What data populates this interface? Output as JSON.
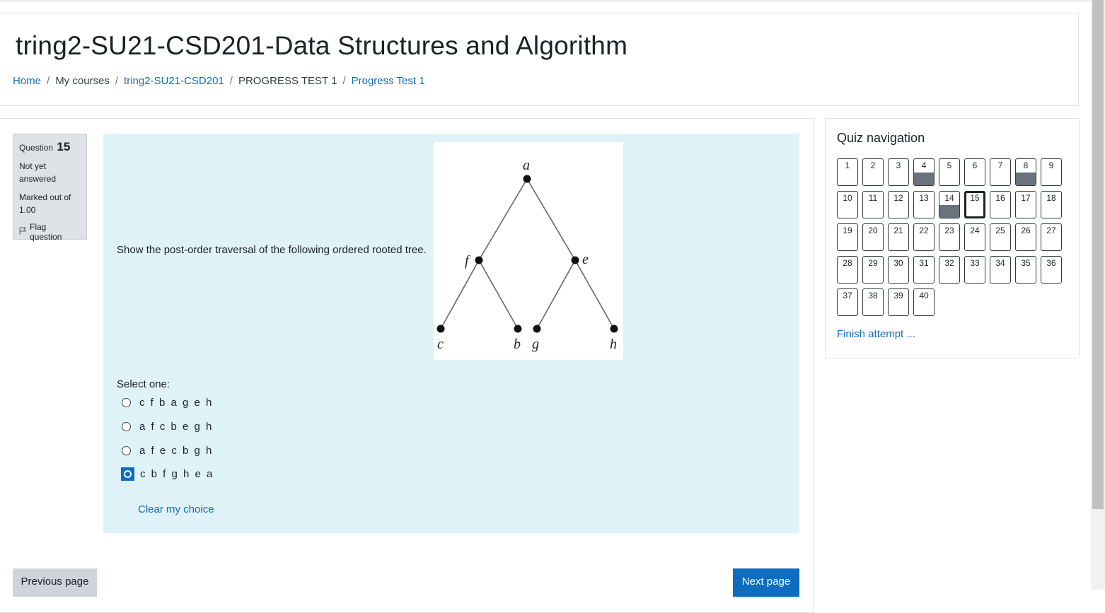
{
  "header": {
    "course_title": "tring2-SU21-CSD201-Data Structures and Algorithm",
    "breadcrumb": [
      {
        "label": "Home",
        "link": true
      },
      {
        "label": "My courses",
        "link": false
      },
      {
        "label": "tring2-SU21-CSD201",
        "link": true
      },
      {
        "label": "PROGRESS TEST 1",
        "link": false
      },
      {
        "label": "Progress Test 1",
        "link": true
      }
    ],
    "separator": "/"
  },
  "question_info": {
    "question_label": "Question",
    "question_number": "15",
    "state": "Not yet answered",
    "grade": "Marked out of 1.00",
    "flag_label": "Flag question"
  },
  "question": {
    "text": "Show the post-order traversal of the following ordered rooted tree.",
    "tree_labels": {
      "a": "a",
      "f": "f",
      "e": "e",
      "c": "c",
      "b": "b",
      "g": "g",
      "h": "h"
    },
    "select_label": "Select one:",
    "options": [
      {
        "label": "c f b a g e h",
        "checked": false
      },
      {
        "label": "a f c b e g h",
        "checked": false
      },
      {
        "label": "a f e c b g h",
        "checked": false
      },
      {
        "label": "c b f g h e a",
        "checked": true
      }
    ],
    "clear_label": "Clear my choice"
  },
  "footer": {
    "prev_label": "Previous page",
    "next_label": "Next page"
  },
  "quiz_nav": {
    "title": "Quiz navigation",
    "questions": [
      {
        "n": "1",
        "answered": false
      },
      {
        "n": "2",
        "answered": false
      },
      {
        "n": "3",
        "answered": false
      },
      {
        "n": "4",
        "answered": true
      },
      {
        "n": "5",
        "answered": false
      },
      {
        "n": "6",
        "answered": false
      },
      {
        "n": "7",
        "answered": false
      },
      {
        "n": "8",
        "answered": true
      },
      {
        "n": "9",
        "answered": false
      },
      {
        "n": "10",
        "answered": false
      },
      {
        "n": "11",
        "answered": false
      },
      {
        "n": "12",
        "answered": false
      },
      {
        "n": "13",
        "answered": false
      },
      {
        "n": "14",
        "answered": true
      },
      {
        "n": "15",
        "answered": false,
        "current": true
      },
      {
        "n": "16",
        "answered": false
      },
      {
        "n": "17",
        "answered": false
      },
      {
        "n": "18",
        "answered": false
      },
      {
        "n": "19",
        "answered": false
      },
      {
        "n": "20",
        "answered": false
      },
      {
        "n": "21",
        "answered": false
      },
      {
        "n": "22",
        "answered": false
      },
      {
        "n": "23",
        "answered": false
      },
      {
        "n": "24",
        "answered": false
      },
      {
        "n": "25",
        "answered": false
      },
      {
        "n": "26",
        "answered": false
      },
      {
        "n": "27",
        "answered": false
      },
      {
        "n": "28",
        "answered": false
      },
      {
        "n": "29",
        "answered": false
      },
      {
        "n": "30",
        "answered": false
      },
      {
        "n": "31",
        "answered": false
      },
      {
        "n": "32",
        "answered": false
      },
      {
        "n": "33",
        "answered": false
      },
      {
        "n": "34",
        "answered": false
      },
      {
        "n": "35",
        "answered": false
      },
      {
        "n": "36",
        "answered": false
      },
      {
        "n": "37",
        "answered": false
      },
      {
        "n": "38",
        "answered": false
      },
      {
        "n": "39",
        "answered": false
      },
      {
        "n": "40",
        "answered": false
      }
    ],
    "finish_label": "Finish attempt ..."
  },
  "colors": {
    "link": "#0f6cbf",
    "formulation_bg": "#def2f8",
    "answered_fill": "#6a737b",
    "info_bg": "#dee2e6"
  }
}
